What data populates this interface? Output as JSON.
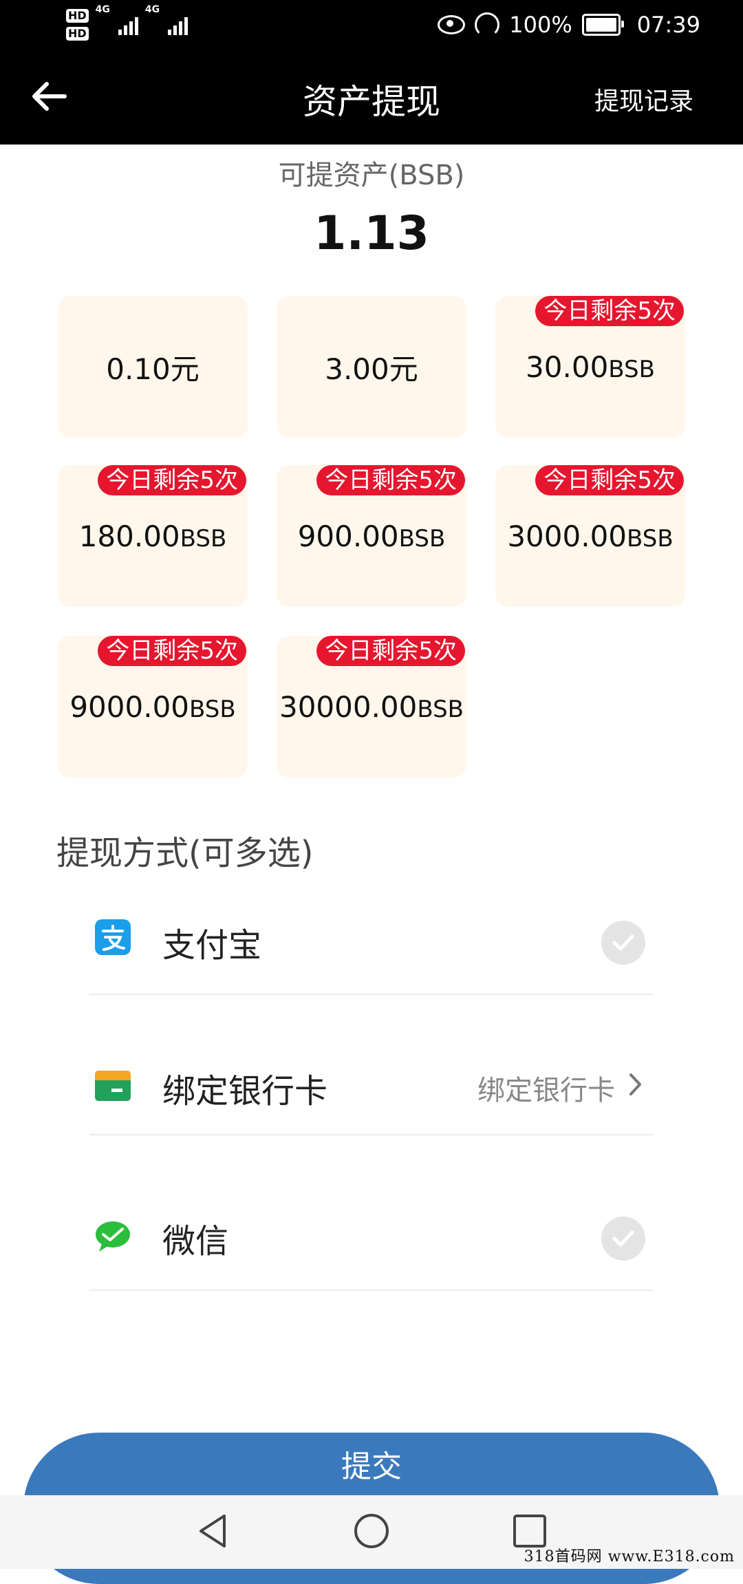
{
  "status_bar": {
    "hd1": "HD",
    "hd2": "HD",
    "net1": "4G",
    "net2": "4G",
    "battery": "100%",
    "time": "07:39",
    "icons": [
      "eye-icon",
      "speed-icon",
      "battery-icon"
    ]
  },
  "header": {
    "back_icon": "arrow-left-icon",
    "title": "资产提现",
    "record_link": "提现记录"
  },
  "asset": {
    "label": "可提资产(BSB)",
    "value": "1.13"
  },
  "options": [
    {
      "amount": "0.10",
      "unit": "元",
      "badge": ""
    },
    {
      "amount": "3.00",
      "unit": "元",
      "badge": ""
    },
    {
      "amount": "30.00",
      "unit": "BSB",
      "badge": "今日剩余5次"
    },
    {
      "amount": "180.00",
      "unit": "BSB",
      "badge": "今日剩余5次"
    },
    {
      "amount": "900.00",
      "unit": "BSB",
      "badge": "今日剩余5次"
    },
    {
      "amount": "3000.00",
      "unit": "BSB",
      "badge": "今日剩余5次"
    },
    {
      "amount": "9000.00",
      "unit": "BSB",
      "badge": "今日剩余5次"
    },
    {
      "amount": "30000.00",
      "unit": "BSB",
      "badge": "今日剩余5次"
    }
  ],
  "methods": {
    "title": "提现方式(可多选)",
    "items": [
      {
        "label": "支付宝",
        "icon": "alipay-icon",
        "action": "check-icon"
      },
      {
        "label": "绑定银行卡",
        "icon": "bank-card-icon",
        "value": "绑定银行卡",
        "action": "chevron-right-icon"
      },
      {
        "label": "微信",
        "icon": "wechat-icon",
        "action": "check-icon"
      }
    ]
  },
  "submit_label": "提交",
  "nav": {
    "icons": [
      "back-triangle-icon",
      "home-circle-icon",
      "recents-square-icon"
    ]
  },
  "watermark": "318首码网  www.E318.com",
  "colors": {
    "badge": "#e5162e",
    "tile_bg": "#fff7ec",
    "submit": "#3b79bd",
    "alipay": "#1a9ee8",
    "wechat": "#2bbd3c",
    "bank_top": "#f5a623",
    "bank_bottom": "#23a05a"
  }
}
